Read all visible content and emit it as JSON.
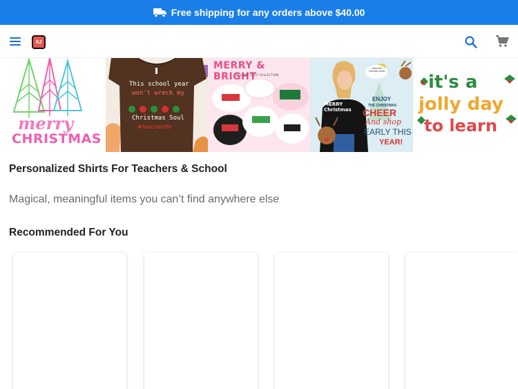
{
  "promo": {
    "text": "Free shipping for any orders above $40.00",
    "icon": "truck-icon"
  },
  "header": {
    "menu_icon": "hamburger-menu-icon",
    "logo_text": "KJ",
    "search_icon": "search-icon",
    "cart_icon": "cart-icon"
  },
  "banner": {
    "slides": [
      {
        "lines": [
          "merry",
          "CHRISTMAS"
        ]
      },
      {
        "lines": [
          "This school year",
          "won't wreck my",
          "Christmas Soul",
          "#teacherlife"
        ]
      },
      {
        "lines": [
          "MERRY & BRIGHT",
          "HOLIDAY 2022 COLLECTION"
        ]
      },
      {
        "lines": [
          "MERRY Christmas",
          "Have the merriest week!",
          "ENJOY",
          "THE CHRISTMAS",
          "CHEER",
          "And shop",
          "EARLY THIS",
          "YEAR!"
        ]
      },
      {
        "lines": [
          "it's a",
          "jolly day",
          "to learn"
        ]
      }
    ]
  },
  "main": {
    "title": "Personalized Shirts For Teachers & School",
    "subtitle": "Magical, meaningful items you can’t find anywhere else",
    "recommended_heading": "Recommended For You"
  },
  "colors": {
    "accent": "#1a7ee8",
    "promo_bg": "#1a7ee8",
    "icon_blue": "#1a6fd6",
    "cart_gray": "#757575",
    "logo_red": "#e5574f"
  }
}
